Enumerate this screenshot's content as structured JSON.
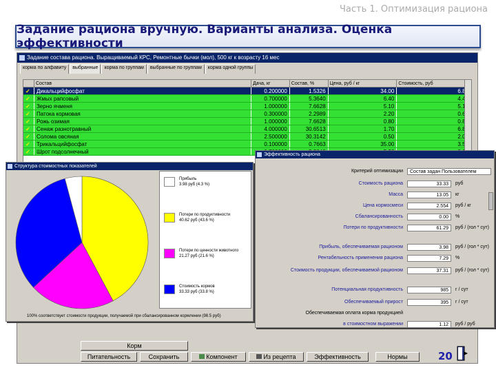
{
  "slide": {
    "header": "Часть 1. Оптимизация рациона",
    "title": "Задание рациона вручную. Варианты анализа. Оценка эффективности",
    "page_number": "20"
  },
  "main_window": {
    "title": "Задание состава рациона. Выращиваемый КРС, Ремонтные бычки (мол), 500 кг к возрасту 16 мес",
    "tabs": [
      "корма по алфавиту",
      "выбранные",
      "корма по группам",
      "выбранные по группам",
      "корма одной группы"
    ],
    "columns": [
      "Состав",
      "Дача, кг",
      "Состав, %",
      "Цена, руб / кг",
      "Стоимость, руб"
    ],
    "rows": [
      {
        "name": "Дикальцийфосфат",
        "dacha": "0.200000",
        "sostav": "1.5326",
        "price": "34.00",
        "cost": "6.80"
      },
      {
        "name": "Жмых рапсовый",
        "dacha": "0.700000",
        "sostav": "5.3640",
        "price": "6.40",
        "cost": "4.40"
      },
      {
        "name": "Зерно ячменя",
        "dacha": "1.000000",
        "sostav": "7.6628",
        "price": "5.10",
        "cost": "5.10"
      },
      {
        "name": "Патока кормовая",
        "dacha": "0.300000",
        "sostav": "2.2989",
        "price": "2.20",
        "cost": "0.66"
      },
      {
        "name": "Рожь озимая",
        "dacha": "1.000000",
        "sostav": "7.6628",
        "price": "0.80",
        "cost": "0.80"
      },
      {
        "name": "Сенаж разнотравный",
        "dacha": "4.000000",
        "sostav": "30.6513",
        "price": "1.70",
        "cost": "6.80"
      },
      {
        "name": "Солома овсяная",
        "dacha": "2.500000",
        "sostav": "30.3142",
        "price": "0.50",
        "cost": "2.00"
      },
      {
        "name": "Трикальцийфосфат",
        "dacha": "0.100000",
        "sostav": "0.7663",
        "price": "35.00",
        "cost": "3.50"
      },
      {
        "name": "Шрот подсолнечный",
        "dacha": "0.700000",
        "sostav": "5.3640",
        "price": "5.20",
        "cost": "3.64"
      }
    ],
    "buttons": {
      "korm": "Корм",
      "pitatelnost": "Питательность",
      "sohranit": "Сохранить",
      "komponent": "Компонент",
      "iz_receptа": "Из рецепта",
      "effektivnost": "Эффективность",
      "normy": "Нормы"
    }
  },
  "pie_window": {
    "title": "Структура стоимостных показателей",
    "legend": [
      {
        "label": "Прибыль",
        "value": "3.98 руб   (4.3 %)",
        "color": "#ffffff"
      },
      {
        "label": "Потери по продуктивности",
        "value": "40.62 руб   (43.6 %)",
        "color": "#ffff00"
      },
      {
        "label": "Потери по ценности животного",
        "value": "21.27 руб   (21.6 %)",
        "color": "#ff00ff"
      },
      {
        "label": "Стоимость кормов",
        "value": "33.33 руб   (33.8 %)",
        "color": "#0000ff"
      }
    ],
    "footer": "100% соответствует стоимости продукции, получаемой при сбалансированном кормлении (98.5 руб)",
    "chart_data": {
      "type": "pie",
      "labels": [
        "Прибыль",
        "Потери по продуктивности",
        "Потери по ценности животного",
        "Стоимость кормов"
      ],
      "values": [
        4.3,
        43.6,
        21.6,
        33.8
      ],
      "colors": [
        "#ffffff",
        "#ffff00",
        "#ff00ff",
        "#0000ff"
      ]
    }
  },
  "eff_window": {
    "title": "Эффективность рациона",
    "rows": [
      {
        "label": "Критерий оптимизации",
        "value": "Состав задан Пользователем",
        "unit": "",
        "plain": true,
        "wide": true
      },
      {
        "label": "Стоимость рациона",
        "value": "33.33",
        "unit": "руб"
      },
      {
        "label": "Масса",
        "value": "13.05",
        "unit": "кг"
      },
      {
        "label": "Цена кормосмеси",
        "value": "2.554",
        "unit": "руб / кг"
      },
      {
        "label": "Сбалансированность",
        "value": "0.00",
        "unit": "%"
      },
      {
        "label": "Потери по продуктивности",
        "value": "61.29",
        "unit": "руб / (гол * сут)"
      },
      {
        "label": "Прибыль, обеспечиваемая рационом",
        "value": "3.98",
        "unit": "руб / (гол * сут)"
      },
      {
        "label": "Рентабельность применения рациона",
        "value": "7.29",
        "unit": "%"
      },
      {
        "label": "Стоимость продукции, обеспечиваемой рационом",
        "value": "37.31",
        "unit": "руб / (гол * сут)"
      },
      {
        "label": "Потенциальная продуктивность",
        "value": "985",
        "unit": "г / сут"
      },
      {
        "label": "Обеспечиваемый прирост",
        "value": "395",
        "unit": "г / сут"
      },
      {
        "label": "Обеспечиваемая оплата корма продукцией",
        "value": "",
        "unit": "",
        "plain": true,
        "nobox": true
      },
      {
        "label": "в стоимостном выражении",
        "value": "1.12",
        "unit": "руб / руб"
      }
    ]
  }
}
